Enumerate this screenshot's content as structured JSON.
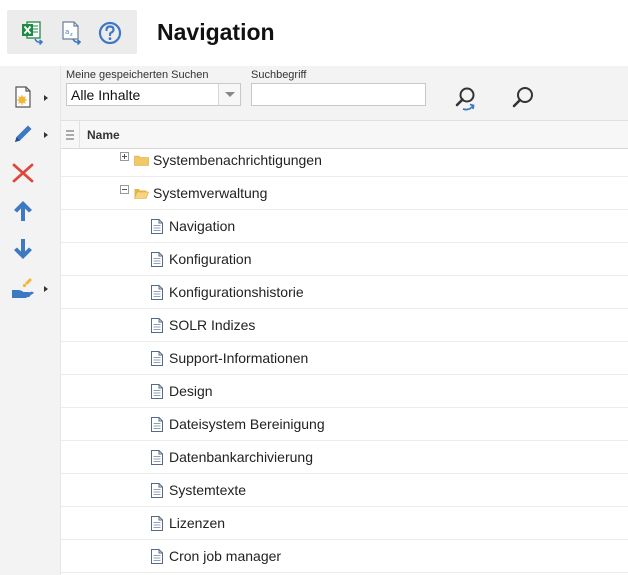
{
  "header": {
    "title": "Navigation",
    "toolbar": [
      {
        "name": "excel-export-icon"
      },
      {
        "name": "text-export-icon"
      },
      {
        "name": "help-icon"
      }
    ]
  },
  "left_toolbar": [
    {
      "name": "new-document-icon",
      "has_menu": true
    },
    {
      "name": "edit-pencil-icon",
      "has_menu": true
    },
    {
      "name": "delete-x-icon",
      "has_menu": false
    },
    {
      "name": "move-up-icon",
      "has_menu": false
    },
    {
      "name": "move-down-icon",
      "has_menu": false
    },
    {
      "name": "handover-icon",
      "has_menu": true
    }
  ],
  "search": {
    "saved_label": "Meine gespeicherten Suchen",
    "saved_value": "Alle Inhalte",
    "term_label": "Suchbegriff",
    "term_value": ""
  },
  "table": {
    "column_name": "Name",
    "rows": [
      {
        "label": "Systembenachrichtigungen",
        "type": "folder",
        "expanded": false
      },
      {
        "label": "Systemverwaltung",
        "type": "folder",
        "expanded": true
      },
      {
        "label": "Navigation",
        "type": "page"
      },
      {
        "label": "Konfiguration",
        "type": "page"
      },
      {
        "label": "Konfigurationshistorie",
        "type": "page"
      },
      {
        "label": "SOLR Indizes",
        "type": "page"
      },
      {
        "label": "Support-Informationen",
        "type": "page"
      },
      {
        "label": "Design",
        "type": "page"
      },
      {
        "label": "Dateisystem Bereinigung",
        "type": "page"
      },
      {
        "label": "Datenbankarchivierung",
        "type": "page"
      },
      {
        "label": "Systemtexte",
        "type": "page"
      },
      {
        "label": "Lizenzen",
        "type": "page"
      },
      {
        "label": "Cron job manager",
        "type": "page"
      }
    ]
  },
  "colors": {
    "accent_blue": "#3d78c2",
    "delete_red": "#e0473a",
    "excel_green": "#1f8a45",
    "folder_yellow": "#f2c766"
  }
}
